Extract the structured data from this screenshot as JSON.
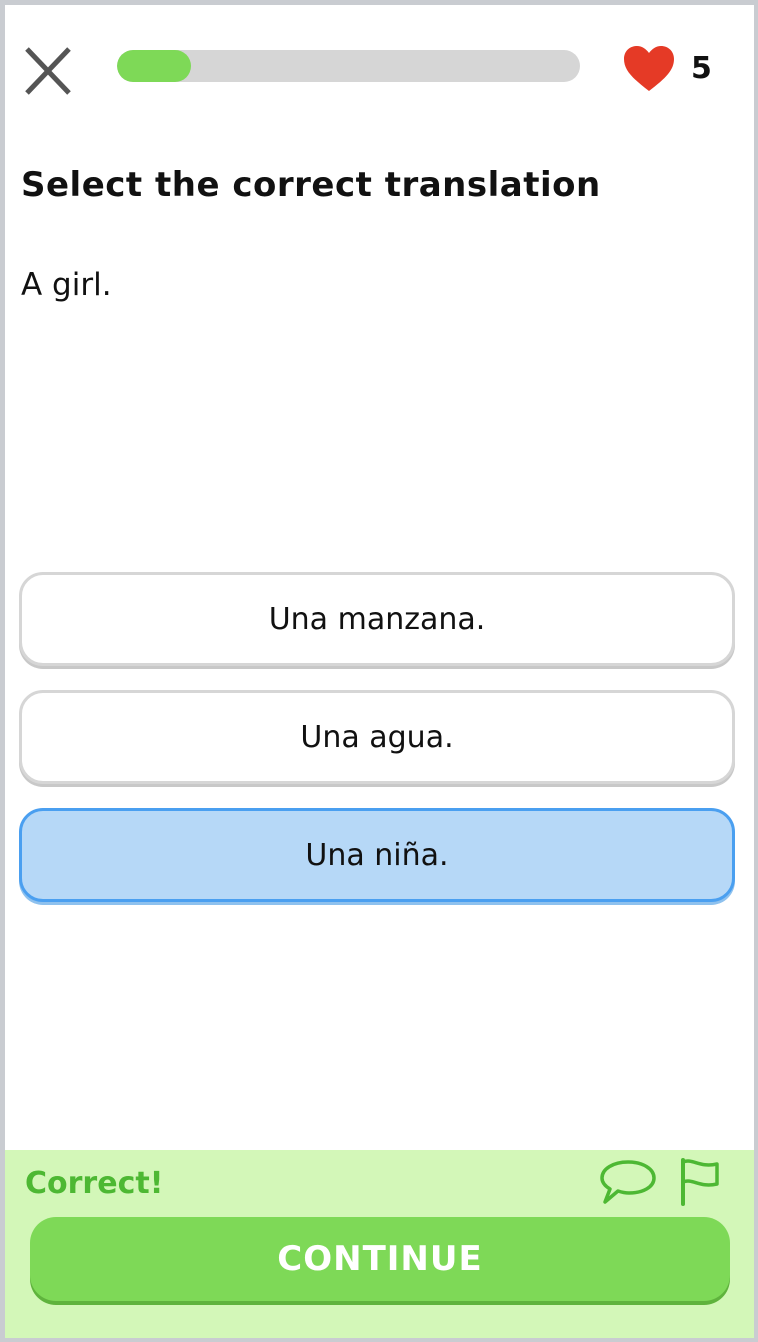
{
  "header": {
    "close_icon": "close-x-icon",
    "progress_fraction": 0.16,
    "progress_color": "#7ed957",
    "hearts_icon": "heart-icon",
    "hearts_color": "#e53a26",
    "hearts_count": "5"
  },
  "exercise": {
    "instruction": "Select the correct translation",
    "prompt": "A girl.",
    "options": [
      {
        "label": "Una manzana.",
        "selected": false
      },
      {
        "label": "Una agua.",
        "selected": false
      },
      {
        "label": "Una niña.",
        "selected": true
      }
    ]
  },
  "feedback": {
    "status_text": "Correct!",
    "status_color": "#4db833",
    "background_color": "#d3f7b8",
    "comment_icon": "speech-bubble-icon",
    "report_icon": "flag-icon",
    "continue_label": "CONTINUE",
    "continue_color": "#7ed957"
  }
}
